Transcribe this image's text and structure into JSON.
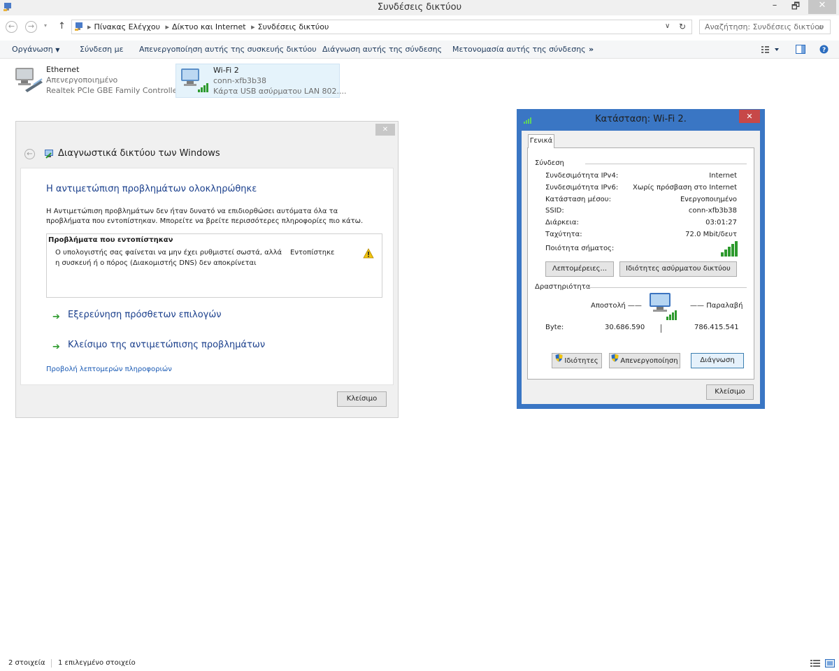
{
  "window": {
    "title": "Συνδέσεις δικτύου",
    "minimize": "–",
    "restore": "🗗",
    "close": "✕"
  },
  "address": {
    "crumbs": [
      "Πίνακας Ελέγχου",
      "Δίκτυο και Internet",
      "Συνδέσεις δικτύου"
    ],
    "search_placeholder": "Αναζήτηση: Συνδέσεις δικτύου"
  },
  "toolbar": {
    "organize": "Οργάνωση",
    "connect": "Σύνδεση με",
    "disable": "Απενεργοποίηση αυτής της συσκευής δικτύου",
    "diagnose": "Διάγνωση αυτής της σύνδεσης",
    "rename": "Μετονομασία αυτής της σύνδεσης",
    "more": "»"
  },
  "connections": [
    {
      "name": "Ethernet",
      "status": "Απενεργοποιημένο",
      "device": "Realtek PCIe GBE Family Controller"
    },
    {
      "name": "Wi-Fi 2",
      "status": "conn-xfb3b38",
      "device": "Κάρτα USB ασύρματου LAN 802...."
    }
  ],
  "diagnostics": {
    "title": "Διαγνωστικά δικτύου των Windows",
    "close_x": "✕",
    "heading": "Η αντιμετώπιση προβλημάτων ολοκληρώθηκε",
    "desc_line1": "Η Αντιμετώπιση προβλημάτων δεν ήταν δυνατό να επιδιορθώσει αυτόματα όλα τα",
    "desc_line2": "προβλήματα που εντοπίστηκαν. Μπορείτε να βρείτε περισσότερες πληροφορίες πιο κάτω.",
    "problems_header": "Προβλήματα που εντοπίστηκαν",
    "problem_line1": "Ο υπολογιστής σας φαίνεται να μην έχει ρυθμιστεί σωστά, αλλά",
    "problem_line2": "η συσκευή ή ο πόρος (Διακομιστής DNS) δεν αποκρίνεται",
    "problem_status": "Εντοπίστηκε",
    "option_explore": "Εξερεύνηση πρόσθετων επιλογών",
    "option_close": "Κλείσιμο της αντιμετώπισης προβλημάτων",
    "details_link": "Προβολή λεπτομερών πληροφοριών",
    "close_button": "Κλείσιμο"
  },
  "wifi_status": {
    "title": "Κατάσταση: Wi-Fi 2.",
    "close_x": "✕",
    "tab": "Γενικά",
    "connection_label": "Σύνδεση",
    "rows": [
      {
        "label": "Συνδεσιμότητα IPv4:",
        "value": "Internet"
      },
      {
        "label": "Συνδεσιμότητα IPv6:",
        "value": "Χωρίς πρόσβαση στο Internet"
      },
      {
        "label": "Κατάσταση μέσου:",
        "value": "Ενεργοποιημένο"
      },
      {
        "label": "SSID:",
        "value": "conn-xfb3b38"
      },
      {
        "label": "Διάρκεια:",
        "value": "03:01:27"
      },
      {
        "label": "Ταχύτητα:",
        "value": "72.0 Mbit/δευτ"
      }
    ],
    "signal_label": "Ποιότητα σήματος:",
    "details_button": "Λεπτομέρειες...",
    "wireless_props_button": "Ιδιότητες ασύρματου δικτύου",
    "activity_label": "Δραστηριότητα",
    "sent_label": "Αποστολή",
    "received_label": "Παραλαβή",
    "bytes_label": "Byte:",
    "bytes_sent": "30.686.590",
    "bytes_received": "786.415.541",
    "properties_button": "Ιδιότητες",
    "disable_button": "Απενεργοποίηση",
    "diagnose_button": "Διάγνωση",
    "close_button": "Κλείσιμο"
  },
  "statusbar": {
    "items": "2 στοιχεία",
    "selected": "1 επιλεγμένο στοιχείο"
  }
}
